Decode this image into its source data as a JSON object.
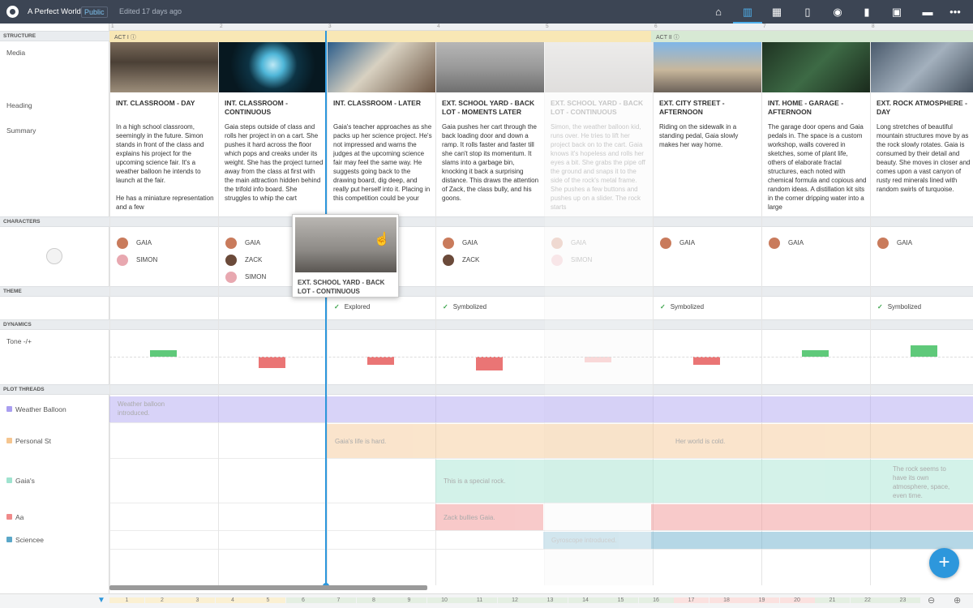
{
  "app": {
    "project_title": "A Perfect World",
    "visibility": "Public",
    "edited": "Edited 17 days ago"
  },
  "toolbar": {
    "icons": [
      "home-icon",
      "columns-icon",
      "grid-icon",
      "single-card-icon",
      "character-icon",
      "stats-icon",
      "media-icon",
      "comment-icon",
      "more-icon"
    ]
  },
  "sections": {
    "structure": "STRUCTURE",
    "characters": "CHARACTERS",
    "theme": "THEME",
    "dynamics": "DYNAMICS",
    "plot_threads": "PLOT THREADS"
  },
  "row_labels": {
    "media": "Media",
    "heading": "Heading",
    "summary": "Summary",
    "tone": "Tone -/+"
  },
  "ruler": [
    "1",
    "2",
    "3",
    "4",
    "5",
    "6",
    "7",
    "8"
  ],
  "acts": [
    {
      "label": "ACT I",
      "color": "#f8e7b5"
    },
    {
      "label": "ACT II",
      "color": "#d7e9d4"
    }
  ],
  "scenes": [
    {
      "heading": "INT. CLASSROOM - DAY",
      "summary": "In a high school classroom, seemingly in the future. Simon stands in front of the class and explains his project for the upcoming science fair. It's a weather balloon he intends to launch at the fair.\n\nHe has a miniature representation and a few",
      "characters": [
        "GAIA",
        "SIMON"
      ],
      "theme": "",
      "tone": 0.3
    },
    {
      "heading": "INT. CLASSROOM - CONTINUOUS",
      "summary": "Gaia steps outside of class and rolls her project in on a cart. She pushes it hard across the floor which pops and creaks under its weight. She has the project turned away from the class at first with the main attraction hidden behind the trifold info board. She struggles to whip the cart",
      "characters": [
        "GAIA",
        "ZACK",
        "SIMON"
      ],
      "theme": "",
      "tone": -0.5
    },
    {
      "heading": "INT. CLASSROOM - LATER",
      "summary": "Gaia's teacher approaches as she packs up her science project. He's not impressed and warns the judges at the upcoming science fair may feel the same way. He suggests going back to the drawing board, dig deep, and really put herself into it. Placing in this competition could be your",
      "characters": [],
      "theme": "Explored",
      "tone": -0.35
    },
    {
      "heading": "EXT. SCHOOL YARD - BACK LOT - MOMENTS LATER",
      "summary": "Gaia pushes her cart through the back loading door and down a ramp. It rolls faster and faster till she can't stop its momentum. It slams into a garbage bin, knocking it back a surprising distance. This draws the attention of Zack, the class bully, and his goons.",
      "characters": [
        "GAIA",
        "ZACK"
      ],
      "theme": "Symbolized",
      "tone": -0.6
    },
    {
      "heading": "EXT. SCHOOL YARD - BACK LOT - CONTINUOUS",
      "summary": "Simon, the weather balloon kid, runs over. He tries to lift her project back on to the cart. Gaia knows it's hopeless and rolls her eyes a bit. She grabs the pipe off the ground and snaps it to the side of the rock's metal frame. She pushes a few buttons and pushes up on a slider. The rock starts",
      "characters": [
        "GAIA",
        "SIMON"
      ],
      "theme": "",
      "tone": -0.25
    },
    {
      "heading": "EXT. CITY STREET - AFTERNOON",
      "summary": "Riding on the sidewalk in a standing pedal, Gaia slowly makes her way home.",
      "characters": [
        "GAIA"
      ],
      "theme": "Symbolized",
      "tone": -0.35
    },
    {
      "heading": "INT. HOME - GARAGE - AFTERNOON",
      "summary": "The garage door opens and Gaia pedals in. The space is a custom workshop, walls covered in sketches, some of plant life, others of elaborate fractal structures, each noted with chemical formula and copious and random ideas. A distillation kit sits in the corner dripping water into a large",
      "characters": [
        "GAIA"
      ],
      "theme": "",
      "tone": 0.3
    },
    {
      "heading": "EXT. ROCK ATMOSPHERE - DAY",
      "summary": "Long stretches of beautiful mountain structures move by as the rock slowly rotates. Gaia is consumed by their detail and beauty. She moves in closer and comes upon a vast canyon of rusty red minerals lined with random swirls of turquoise.",
      "characters": [
        "GAIA"
      ],
      "theme": "Symbolized",
      "tone": 0.5
    }
  ],
  "plot_threads": [
    {
      "name": "Weather Balloon",
      "color": "#a99ef0",
      "bands": [
        {
          "text": "Weather balloon introduced."
        }
      ]
    },
    {
      "name": "Personal St",
      "color": "#f5c58f",
      "bands": [
        {
          "text": "Gaia's life is hard."
        },
        {
          "text": "Her world is cold."
        }
      ]
    },
    {
      "name": "Gaia's",
      "color": "#9fe3cf",
      "bands": [
        {
          "text": "This is a special rock."
        },
        {
          "text": "The rock seems to have its own atmosphere, space, even time."
        }
      ]
    },
    {
      "name": "Aa",
      "color": "#f08a8a",
      "bands": [
        {
          "text": "Zack bullies Gaia."
        }
      ]
    },
    {
      "name": "Sciencee",
      "color": "#5aa7c8",
      "bands": [
        {
          "text": "Gyroscope introduced."
        }
      ]
    }
  ],
  "tooltip": {
    "title": "EXT. SCHOOL YARD - BACK LOT - CONTINUOUS"
  },
  "bottom_numbers": [
    "1",
    "2",
    "3",
    "4",
    "5",
    "6",
    "7",
    "8",
    "9",
    "10",
    "11",
    "12",
    "13",
    "14",
    "15",
    "16",
    "17",
    "18",
    "19",
    "20",
    "21",
    "22",
    "23"
  ],
  "colors": {
    "accent": "#2d97dc",
    "topbar": "#3c4554",
    "tone_positive": "#5fc97a",
    "tone_negative": "#ea7575"
  }
}
